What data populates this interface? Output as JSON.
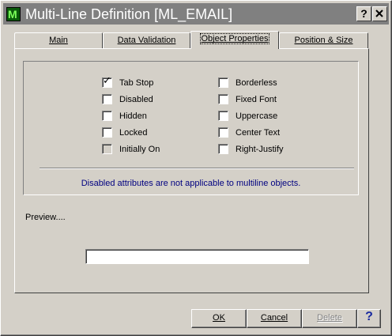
{
  "window": {
    "title": "Multi-Line Definition  [ML_EMAIL]",
    "help_button": "?",
    "close_button": "X"
  },
  "tabs": [
    {
      "label": "Main"
    },
    {
      "label": "Data Validation"
    },
    {
      "label": "Object Properties",
      "active": true
    },
    {
      "label": "Position & Size"
    }
  ],
  "checkboxes_left": [
    {
      "label": "Tab Stop",
      "checked": true,
      "enabled": true
    },
    {
      "label": "Disabled",
      "checked": false,
      "enabled": true
    },
    {
      "label": "Hidden",
      "checked": false,
      "enabled": true
    },
    {
      "label": "Locked",
      "checked": false,
      "enabled": true
    },
    {
      "label": "Initially On",
      "checked": false,
      "enabled": false
    }
  ],
  "checkboxes_right": [
    {
      "label": "Borderless",
      "checked": false,
      "enabled": true
    },
    {
      "label": "Fixed Font",
      "checked": false,
      "enabled": true
    },
    {
      "label": "Uppercase",
      "checked": false,
      "enabled": true
    },
    {
      "label": "Center Text",
      "checked": false,
      "enabled": true
    },
    {
      "label": "Right-Justify",
      "checked": false,
      "enabled": true
    }
  ],
  "note": "Disabled attributes are not applicable to multiline objects.",
  "preview": {
    "label": "Preview....",
    "value": ""
  },
  "buttons": {
    "ok": "OK",
    "cancel": "Cancel",
    "delete": "Delete",
    "help": "?"
  },
  "colors": {
    "face": "#d4d0c8",
    "titlebar_inactive": "#808080",
    "note_text": "#000080"
  }
}
